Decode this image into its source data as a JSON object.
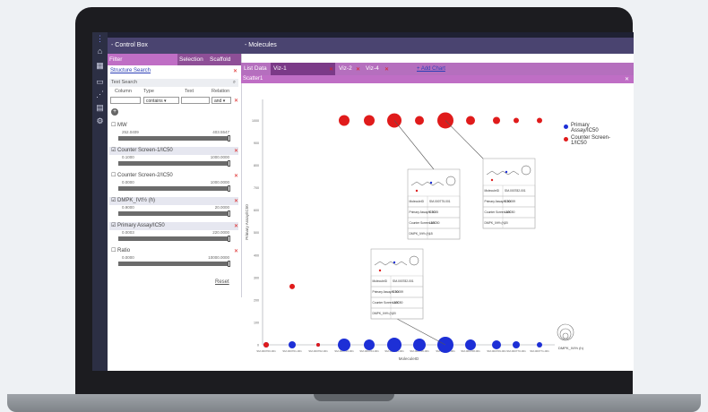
{
  "control_box": {
    "title": "- Control Box",
    "tabs": [
      "Filter",
      "Selection",
      "Scaffold"
    ],
    "structure_search": "Structure Search",
    "text_search": "Text Search",
    "columns": [
      "Column",
      "Type",
      "Text",
      "Relation"
    ],
    "type_value": "contains",
    "relation_value": "and",
    "filters": [
      {
        "name": "MW",
        "checked": false,
        "min": "252.0409",
        "max": "403.5547"
      },
      {
        "name": "Counter Screen-1/IC50",
        "checked": true,
        "min": "0.1000",
        "max": "1000.0000"
      },
      {
        "name": "Counter Screen-2/IC50",
        "checked": false,
        "min": "0.0000",
        "max": "1000.0000"
      },
      {
        "name": "DMPK_IVt½ (h)",
        "checked": true,
        "min": "0.9000",
        "max": "20.0000"
      },
      {
        "name": "Primary Assay/IC50",
        "checked": true,
        "min": "0.0003",
        "max": "220.0000"
      },
      {
        "name": "Ratio",
        "checked": false,
        "min": "0.0000",
        "max": "10000.0000"
      }
    ],
    "reset": "Reset"
  },
  "molecules": {
    "title": "- Molecules",
    "tabs": [
      "List Data",
      "Viz-1",
      "Viz-2",
      "Viz-4"
    ],
    "add_chart": "+ Add Chart",
    "scatter_title": "Scatter1"
  },
  "colors": {
    "primary": "#1d2fd6",
    "counter": "#e01b1b",
    "header": "#4a4470",
    "tab": "#b56fbe"
  },
  "chart_data": {
    "type": "scatter",
    "xlabel": "MoleculeID",
    "ylabel": "Primary Assay/IC50",
    "ylim": [
      0,
      1050
    ],
    "yticks": [
      0,
      100,
      200,
      300,
      400,
      500,
      600,
      700,
      800,
      900,
      1000
    ],
    "series": [
      {
        "name": "Primary Assay/IC50",
        "color": "#1d2fd6",
        "points": [
          {
            "x": 1,
            "y": 0,
            "size": 3
          },
          {
            "x": 2,
            "y": 0,
            "size": 4
          },
          {
            "x": 3,
            "y": 0,
            "size": 2
          },
          {
            "x": 4,
            "y": 0,
            "size": 7
          },
          {
            "x": 5,
            "y": 0,
            "size": 6
          },
          {
            "x": 6,
            "y": 0,
            "size": 8
          },
          {
            "x": 7,
            "y": 0,
            "size": 7
          },
          {
            "x": 8,
            "y": 0,
            "size": 9
          },
          {
            "x": 9,
            "y": 0,
            "size": 6
          },
          {
            "x": 10,
            "y": 0,
            "size": 5
          },
          {
            "x": 11,
            "y": 0,
            "size": 4
          },
          {
            "x": 12,
            "y": 0,
            "size": 3
          }
        ]
      },
      {
        "name": "Counter Screen-1/IC50",
        "color": "#e01b1b",
        "points": [
          {
            "x": 1,
            "y": 0,
            "size": 3
          },
          {
            "x": 2,
            "y": 260,
            "size": 3
          },
          {
            "x": 3,
            "y": 0,
            "size": 2
          },
          {
            "x": 4,
            "y": 1000,
            "size": 6
          },
          {
            "x": 5,
            "y": 1000,
            "size": 6
          },
          {
            "x": 6,
            "y": 1000,
            "size": 8
          },
          {
            "x": 7,
            "y": 1000,
            "size": 5
          },
          {
            "x": 8,
            "y": 1000,
            "size": 9
          },
          {
            "x": 9,
            "y": 1000,
            "size": 5
          },
          {
            "x": 10,
            "y": 1000,
            "size": 4
          },
          {
            "x": 11,
            "y": 1000,
            "size": 3
          },
          {
            "x": 12,
            "y": 1000,
            "size": 3
          }
        ]
      }
    ],
    "legend": {
      "position": "top-right",
      "entries": [
        "Primary Assay/IC50",
        "Counter Screen-1/IC50"
      ]
    },
    "size_legend": "DMPK_IVt½ (h)",
    "tooltips": [
      {
        "rows": [
          [
            "MoleculeID",
            "SM-000775-001"
          ],
          [
            "Primary Assay/IC50",
            "0.0035"
          ],
          [
            "Counter Screen-1/IC50",
            "1000"
          ],
          [
            "DMPK_IVt½ (h)",
            "15"
          ]
        ]
      },
      {
        "rows": [
          [
            "MoleculeID",
            "SM-000782-001"
          ],
          [
            "Primary Assay/IC50",
            "0.00059"
          ],
          [
            "Counter Screen-1/IC50",
            "1000"
          ],
          [
            "DMPK_IVt½ (h)",
            "20"
          ]
        ]
      },
      {
        "rows": [
          [
            "MoleculeID",
            "SM-000782-001"
          ],
          [
            "Primary Assay/IC50",
            "0.00059"
          ],
          [
            "Counter Screen-1/IC50",
            "1000"
          ],
          [
            "DMPK_IVt½ (h)",
            "20"
          ]
        ]
      }
    ]
  }
}
